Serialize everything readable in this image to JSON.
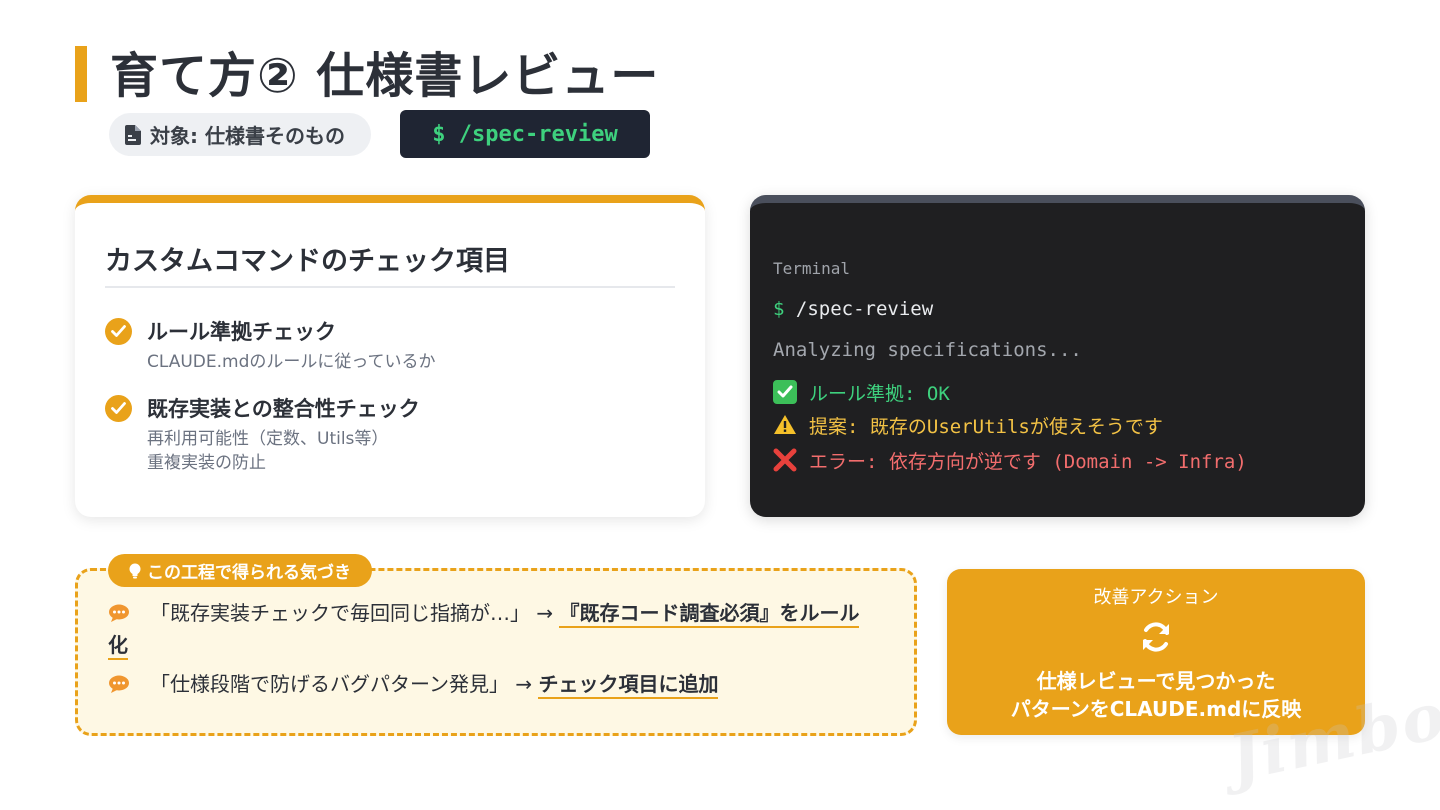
{
  "title": "育て方② 仕様書レビュー",
  "target": {
    "label": "対象: 仕様書そのもの",
    "icon": "document-icon"
  },
  "command": "$ /spec-review",
  "checklist": {
    "heading": "カスタムコマンドのチェック項目",
    "items": [
      {
        "title": "ルール準拠チェック",
        "details": [
          "CLAUDE.mdのルールに従っているか"
        ]
      },
      {
        "title": "既存実装との整合性チェック",
        "details": [
          "再利用可能性（定数、Utils等）",
          "重複実装の防止"
        ]
      }
    ]
  },
  "terminal": {
    "label": "Terminal",
    "prompt": "$",
    "command": "/spec-review",
    "analyzing": "Analyzing specifications...",
    "results": [
      {
        "type": "ok",
        "icon": "check-mark-icon",
        "text": "ルール準拠: OK"
      },
      {
        "type": "warn",
        "icon": "warning-icon",
        "text": "提案: 既存のUserUtilsが使えそうです"
      },
      {
        "type": "err",
        "icon": "cross-mark-icon",
        "text": "エラー: 依存方向が逆です (Domain -> Infra)"
      }
    ]
  },
  "insights": {
    "tag": "この工程で得られる気づき",
    "items": [
      {
        "quote": "「既存実装チェックで毎回同じ指摘が…」",
        "arrow": "→",
        "action": "『既存コード調査必須』をルール化"
      },
      {
        "quote": "「仕様段階で防げるバグパターン発見」",
        "arrow": "→",
        "action": "チェック項目に追加"
      }
    ]
  },
  "improvement": {
    "label": "改善アクション",
    "icon": "refresh-icon",
    "text_line1": "仕様レビューで見つかった",
    "text_line2": "パターンをCLAUDE.mdに反映"
  },
  "watermark": "Jimbo",
  "colors": {
    "accent": "#e9a21a",
    "terminal_bg": "#1f1f21",
    "ok": "#3ed17e",
    "warn": "#f3c245",
    "err": "#f26d6d"
  }
}
